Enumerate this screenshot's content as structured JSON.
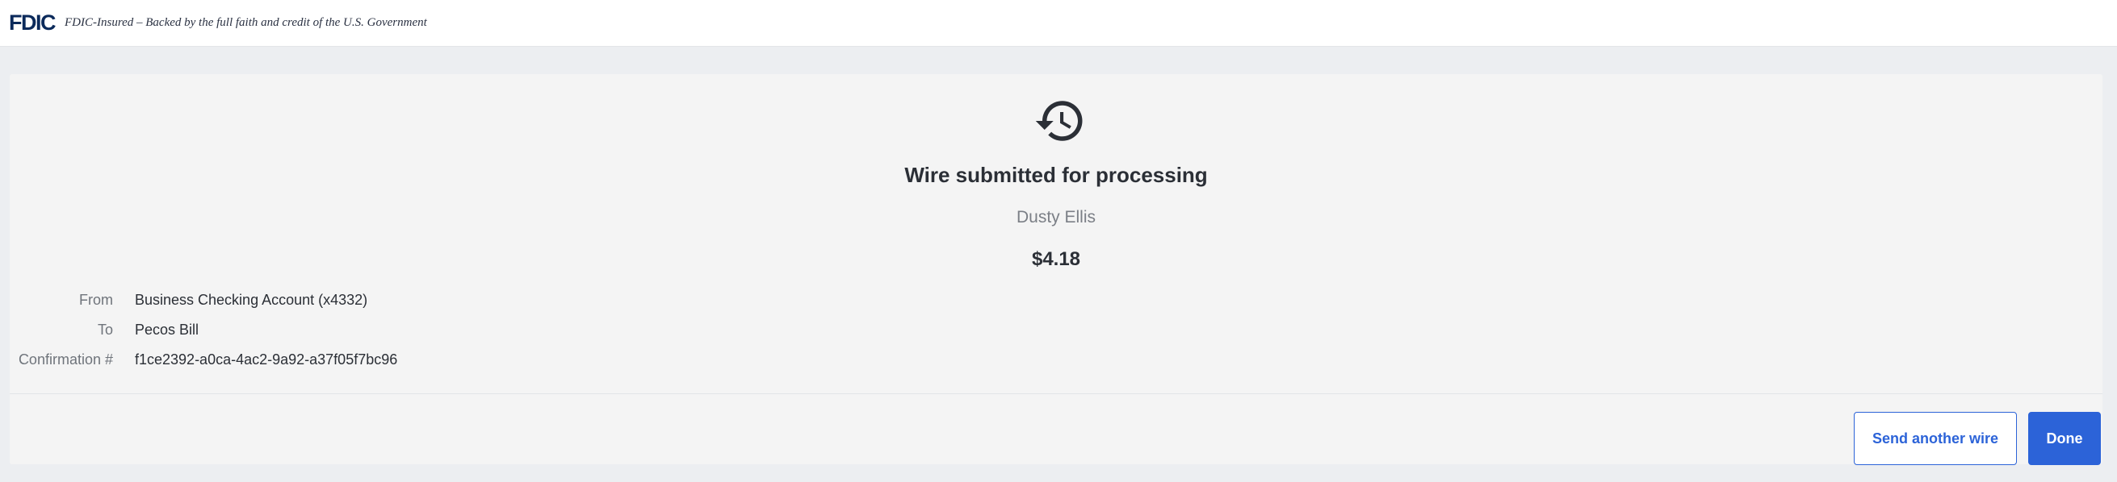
{
  "fdic_banner": {
    "logo": "FDIC",
    "text": "FDIC-Insured – Backed by the full faith and credit of the U.S. Government"
  },
  "confirmation": {
    "icon": "history-clock-icon",
    "title": "Wire submitted for processing",
    "recipient_name": "Dusty Ellis",
    "amount": "$4.18"
  },
  "details": [
    {
      "label": "From",
      "value": "Business Checking Account (x4332)"
    },
    {
      "label": "To",
      "value": "Pecos Bill"
    },
    {
      "label": "Confirmation #",
      "value": "f1ce2392-a0ca-4ac2-9a92-a37f05f7bc96"
    }
  ],
  "actions": {
    "send_another_label": "Send another wire",
    "done_label": "Done"
  },
  "colors": {
    "accent": "#2c63d8",
    "fdic_navy": "#0b2a5b",
    "page_background": "#eceef1",
    "card_background": "#f4f4f4"
  }
}
